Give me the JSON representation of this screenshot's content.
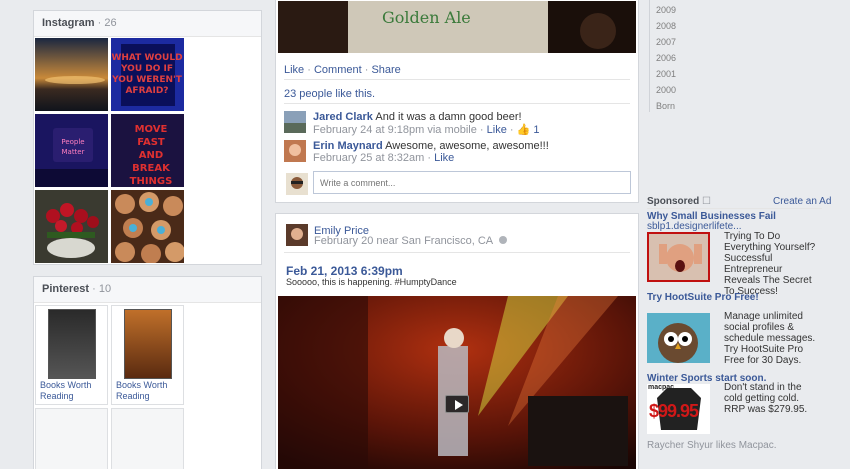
{
  "instagram": {
    "title": "Instagram",
    "count": "· 26"
  },
  "pinterest": {
    "title": "Pinterest",
    "count": "· 10",
    "cards": [
      {
        "label": "Books Worth Reading"
      },
      {
        "label": "Books Worth Reading"
      }
    ]
  },
  "post1": {
    "actions": {
      "like": "Like",
      "sep1": " · ",
      "comment": "Comment",
      "sep2": " · ",
      "share": "Share"
    },
    "likes": "23 people like this.",
    "comments": [
      {
        "author": "Jared Clark",
        "text": "And it was a damn good beer!",
        "meta": "February 24 at 9:18pm via mobile",
        "like": "Like",
        "like_count": "1"
      },
      {
        "author": "Erin Maynard",
        "text": "Awesome, awesome, awesome!!!",
        "meta": "February 25 at 8:32am",
        "like": "Like"
      }
    ],
    "comment_placeholder": "Write a comment..."
  },
  "post2": {
    "author": "Emily Price",
    "meta": "February 20 near San Francisco, CA",
    "date_heading": "Feb 21, 2013 6:39pm",
    "text": "Sooooo, this is happening. #HumptyDance"
  },
  "timeline_years": [
    "2009",
    "2008",
    "2007",
    "2006",
    "2001",
    "2000",
    "Born"
  ],
  "sponsored": {
    "label": "Sponsored",
    "create_ad": "Create an Ad",
    "ads": [
      {
        "title": "Why Small Businesses Fail",
        "url": "sblp1.designerlifete...",
        "text": "Trying To Do Everything Yourself? Successful Entrepreneur Reveals The Secret To Success!"
      },
      {
        "title": "Try HootSuite Pro Free!",
        "text": "Manage unlimited social profiles & schedule messages. Try HootSuite Pro Free for 30 Days."
      },
      {
        "title": "Winter Sports start soon.",
        "text": "Don't stand in the cold getting cold. RRP was $279.95.",
        "social": "Raycher Shyur likes Macpac.",
        "price": "$99.95",
        "brand": "macpac"
      }
    ]
  },
  "colors": {
    "link": "#3b5998",
    "background": "#e9ebee"
  }
}
